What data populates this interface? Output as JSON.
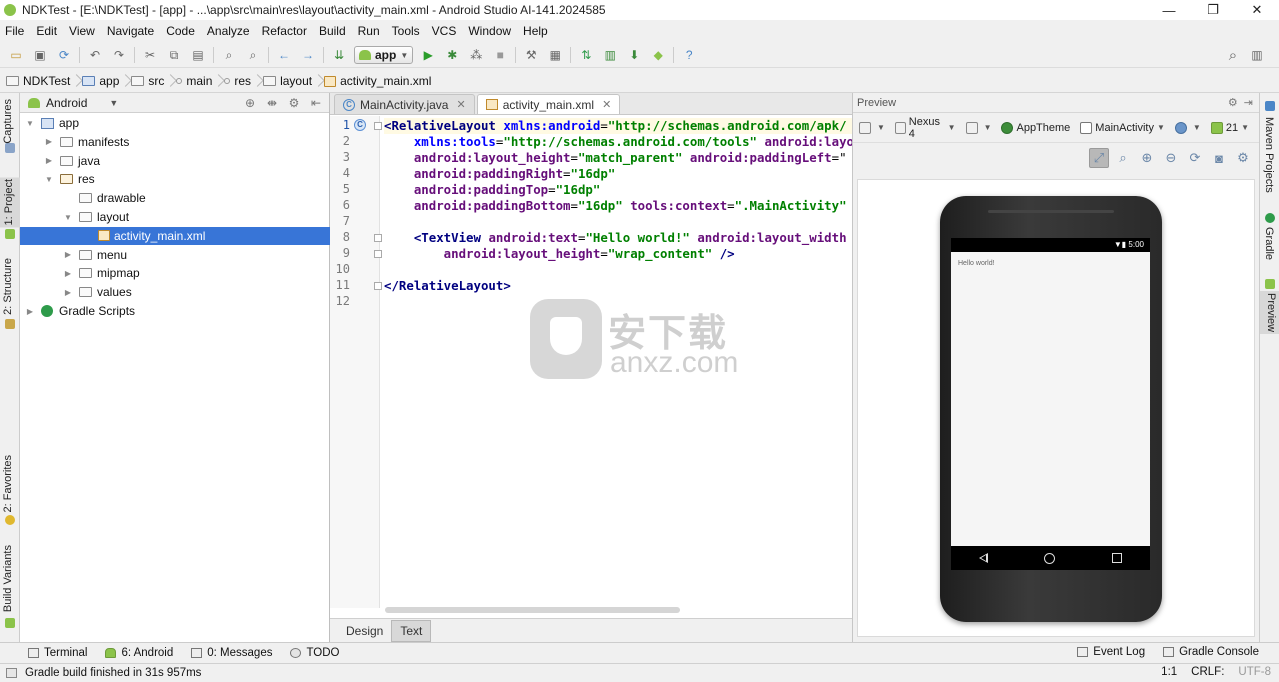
{
  "window": {
    "title": "NDKTest - [E:\\NDKTest] - [app] - ...\\app\\src\\main\\res\\layout\\activity_main.xml - Android Studio AI-141.2024585",
    "minimize": "—",
    "maximize": "❐",
    "close": "✕"
  },
  "menu": [
    "File",
    "Edit",
    "View",
    "Navigate",
    "Code",
    "Analyze",
    "Refactor",
    "Build",
    "Run",
    "Tools",
    "VCS",
    "Window",
    "Help"
  ],
  "toolbar": {
    "run_config": "app",
    "icons": [
      "open-folder-icon",
      "save-icon",
      "sync-icon",
      "undo-icon",
      "redo-icon",
      "cut-icon",
      "copy-icon",
      "paste-icon",
      "find-icon",
      "replace-icon",
      "back-icon",
      "forward-icon",
      "make-icon",
      "run-icon",
      "debug-icon",
      "attach-debugger-icon",
      "stop-icon",
      "sdk-manager-icon",
      "avd-manager-icon",
      "sync-gradle-icon",
      "device-monitor-icon",
      "help-icon"
    ]
  },
  "breadcrumb": [
    "NDKTest",
    "app",
    "src",
    "main",
    "res",
    "layout",
    "activity_main.xml"
  ],
  "project": {
    "view": "Android",
    "tree": [
      {
        "label": "app",
        "depth": 0,
        "expanded": true,
        "kind": "app"
      },
      {
        "label": "manifests",
        "depth": 1,
        "expanded": false,
        "kind": "folder"
      },
      {
        "label": "java",
        "depth": 1,
        "expanded": false,
        "kind": "folder"
      },
      {
        "label": "res",
        "depth": 1,
        "expanded": true,
        "kind": "res"
      },
      {
        "label": "drawable",
        "depth": 2,
        "expanded": null,
        "kind": "folder"
      },
      {
        "label": "layout",
        "depth": 2,
        "expanded": true,
        "kind": "folder"
      },
      {
        "label": "activity_main.xml",
        "depth": 3,
        "expanded": null,
        "kind": "xml",
        "selected": true
      },
      {
        "label": "menu",
        "depth": 2,
        "expanded": false,
        "kind": "folder"
      },
      {
        "label": "mipmap",
        "depth": 2,
        "expanded": false,
        "kind": "folder"
      },
      {
        "label": "values",
        "depth": 2,
        "expanded": false,
        "kind": "folder"
      },
      {
        "label": "Gradle Scripts",
        "depth": 0,
        "expanded": false,
        "kind": "gradle"
      }
    ]
  },
  "left_tabs": [
    "Captures",
    "1: Project",
    "2: Structure",
    "2: Favorites",
    "Build Variants"
  ],
  "right_tabs": [
    "Maven Projects",
    "Gradle",
    "Preview"
  ],
  "editor": {
    "tabs": [
      {
        "label": "MainActivity.java",
        "active": false
      },
      {
        "label": "activity_main.xml",
        "active": true
      }
    ],
    "line_numbers": [
      "1",
      "2",
      "3",
      "4",
      "5",
      "6",
      "7",
      "8",
      "9",
      "10",
      "11",
      "12"
    ],
    "lines": [
      [
        {
          "t": "<RelativeLayout ",
          "c": "tag"
        },
        {
          "t": "xmlns:android",
          "c": "attr"
        },
        {
          "t": "=",
          "c": "pl"
        },
        {
          "t": "\"http://schemas.android.com/apk/",
          "c": "str"
        }
      ],
      [
        {
          "t": "    xmlns:tools",
          "c": "attr"
        },
        {
          "t": "=",
          "c": "pl"
        },
        {
          "t": "\"http://schemas.android.com/tools\"",
          "c": "str"
        },
        {
          "t": " android:layo",
          "c": "attr-n"
        }
      ],
      [
        {
          "t": "    android:layout_height",
          "c": "attr-n"
        },
        {
          "t": "=",
          "c": "pl"
        },
        {
          "t": "\"match_parent\"",
          "c": "str"
        },
        {
          "t": " android:paddingLeft",
          "c": "attr-n"
        },
        {
          "t": "=\"",
          "c": "pl"
        }
      ],
      [
        {
          "t": "    android:paddingRight",
          "c": "attr-n"
        },
        {
          "t": "=",
          "c": "pl"
        },
        {
          "t": "\"16dp\"",
          "c": "str"
        }
      ],
      [
        {
          "t": "    android:paddingTop",
          "c": "attr-n"
        },
        {
          "t": "=",
          "c": "pl"
        },
        {
          "t": "\"16dp\"",
          "c": "str"
        }
      ],
      [
        {
          "t": "    android:paddingBottom",
          "c": "attr-n"
        },
        {
          "t": "=",
          "c": "pl"
        },
        {
          "t": "\"16dp\"",
          "c": "str"
        },
        {
          "t": " tools:context",
          "c": "attr-n"
        },
        {
          "t": "=",
          "c": "pl"
        },
        {
          "t": "\".MainActivity\"",
          "c": "str"
        }
      ],
      [
        {
          "t": "",
          "c": "pl"
        }
      ],
      [
        {
          "t": "    <TextView ",
          "c": "tag"
        },
        {
          "t": "android:text",
          "c": "attr-n"
        },
        {
          "t": "=",
          "c": "pl"
        },
        {
          "t": "\"Hello world!\"",
          "c": "str"
        },
        {
          "t": " android:layout_width",
          "c": "attr-n"
        }
      ],
      [
        {
          "t": "        android:layout_height",
          "c": "attr-n"
        },
        {
          "t": "=",
          "c": "pl"
        },
        {
          "t": "\"wrap_content\"",
          "c": "str"
        },
        {
          "t": " />",
          "c": "tag"
        }
      ],
      [
        {
          "t": "",
          "c": "pl"
        }
      ],
      [
        {
          "t": "</RelativeLayout>",
          "c": "tag"
        }
      ],
      [
        {
          "t": "",
          "c": "pl"
        }
      ]
    ],
    "gutter_marker": "C",
    "bottom_tabs": [
      {
        "label": "Design",
        "active": false
      },
      {
        "label": "Text",
        "active": true
      }
    ]
  },
  "watermark": {
    "cn": "安下载",
    "en": "anxz.com"
  },
  "preview": {
    "title": "Preview",
    "device": "Nexus 4",
    "theme": "AppTheme",
    "activity": "MainActivity",
    "api": "21",
    "status_time": "5:00",
    "hello_text": "Hello world!"
  },
  "bottom_tools": {
    "left": [
      {
        "label": "Terminal",
        "icon": "terminal-icon"
      },
      {
        "label": "6: Android",
        "icon": "android-icon"
      },
      {
        "label": "0: Messages",
        "icon": "messages-icon"
      },
      {
        "label": "TODO",
        "icon": "todo-icon"
      }
    ],
    "right": [
      {
        "label": "Event Log",
        "icon": "event-log-icon"
      },
      {
        "label": "Gradle Console",
        "icon": "gradle-console-icon"
      }
    ]
  },
  "status": {
    "message": "Gradle build finished in 31s 957ms",
    "position": "1:1",
    "line_sep": "CRLF:",
    "encoding": "UTF-8"
  },
  "colors": {
    "selection": "#3875d7",
    "tag": "#000080",
    "attr": "#0000ff",
    "attr_name": "#660e7a",
    "string": "#008000",
    "android_green": "#8bc34a"
  }
}
